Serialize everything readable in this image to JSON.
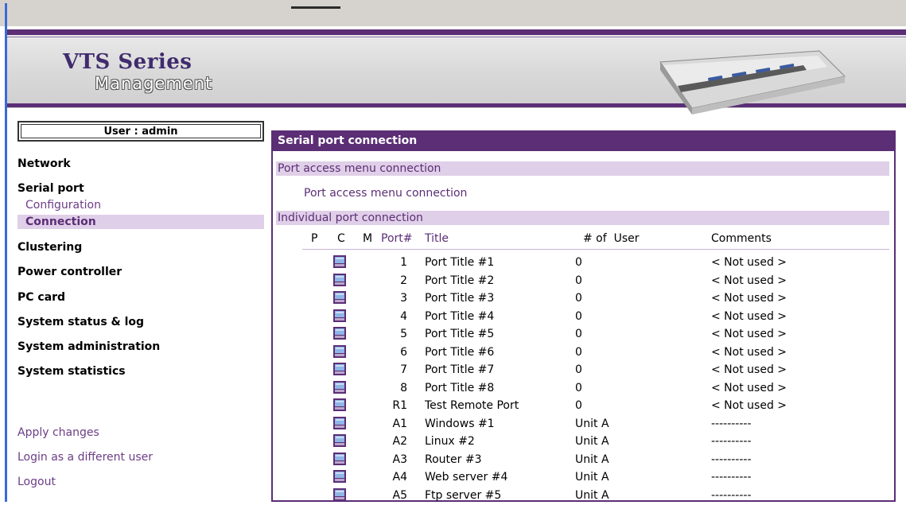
{
  "brand": {
    "title": "VTS Series",
    "subtitle": "Management"
  },
  "user": {
    "label": "User : admin"
  },
  "sidebar": {
    "nav": [
      "Network",
      "Serial port",
      "Clustering",
      "Power controller",
      "PC card",
      "System status & log",
      "System administration",
      "System statistics"
    ],
    "serial_sub": [
      "Configuration",
      "Connection"
    ],
    "actions": [
      "Apply changes",
      "Login as a different user",
      "Logout"
    ]
  },
  "panel": {
    "title": "Serial port connection",
    "section1": "Port access menu connection",
    "menu_link": "Port access menu connection",
    "section2": "Individual port connection"
  },
  "table": {
    "headers": {
      "p": "P",
      "c": "C",
      "m": "M",
      "port": "Port#",
      "title": "Title",
      "num": "# of  User",
      "comments": "Comments"
    },
    "rows": [
      {
        "port": "1",
        "title": "Port Title #1",
        "num": "0",
        "comment": "< Not used >"
      },
      {
        "port": "2",
        "title": "Port Title #2",
        "num": "0",
        "comment": "< Not used >"
      },
      {
        "port": "3",
        "title": "Port Title #3",
        "num": "0",
        "comment": "< Not used >"
      },
      {
        "port": "4",
        "title": "Port Title #4",
        "num": "0",
        "comment": "< Not used >"
      },
      {
        "port": "5",
        "title": "Port Title #5",
        "num": "0",
        "comment": "< Not used >"
      },
      {
        "port": "6",
        "title": "Port Title #6",
        "num": "0",
        "comment": "< Not used >"
      },
      {
        "port": "7",
        "title": "Port Title #7",
        "num": "0",
        "comment": "< Not used >"
      },
      {
        "port": "8",
        "title": "Port Title #8",
        "num": "0",
        "comment": "< Not used >"
      },
      {
        "port": "R1",
        "title": "Test Remote Port",
        "num": "0",
        "comment": "< Not used >"
      },
      {
        "port": "A1",
        "title": "Windows #1",
        "num": "Unit A",
        "comment": "----------"
      },
      {
        "port": "A2",
        "title": "Linux #2",
        "num": "Unit A",
        "comment": "----------"
      },
      {
        "port": "A3",
        "title": "Router #3",
        "num": "Unit A",
        "comment": "----------"
      },
      {
        "port": "A4",
        "title": "Web server #4",
        "num": "Unit A",
        "comment": "----------"
      },
      {
        "port": "A5",
        "title": "Ftp server #5",
        "num": "Unit A",
        "comment": "----------"
      }
    ],
    "icon": "monitor-icon",
    "icon_color": "#5b2e75"
  },
  "colors": {
    "accent": "#5b2e75",
    "section_bg": "#e0cfe8",
    "link": "#6b3d86"
  }
}
